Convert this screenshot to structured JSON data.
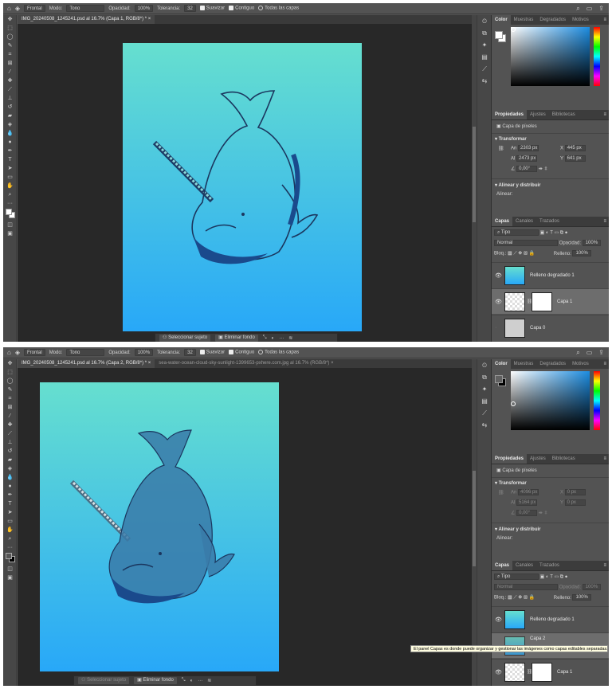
{
  "optbar": {
    "mode_label": "Frontal",
    "modo_label": "Modo:",
    "modo_value": "Tono",
    "opacidad_label": "Opacidad:",
    "opacidad_value": "100%",
    "tolerancia_label": "Tolerancia:",
    "tolerancia_value": "32",
    "suavizar": "Suavizar",
    "contiguo": "Contiguo",
    "todas": "Todas las capas"
  },
  "top": {
    "tabs": [
      {
        "label": "IMG_20240508_1245241.psd al 16.7% (Capa 1, RGB/8*) *"
      }
    ],
    "ctx": {
      "select": "Seleccionar sujeto",
      "remove": "Eliminar fondo",
      "more": "···"
    },
    "props": {
      "layer_type": "Capa de píxeles",
      "transform": "Transformar",
      "an_label": "An",
      "an": "2303 px",
      "al_label": "Al",
      "al": "2473 px",
      "x_label": "X",
      "x": "445 px",
      "y_label": "Y",
      "y": "641 px",
      "angle": "0,00°",
      "align": "Alinear y distribuir",
      "align_sub": "Alinear:"
    },
    "layers": [
      {
        "name": "Relleno degradado 1",
        "visible": true
      },
      {
        "name": "Capa 1",
        "visible": true,
        "selected": true
      },
      {
        "name": "Capa 0",
        "visible": false
      }
    ]
  },
  "bottom": {
    "tabs": [
      {
        "label": "IMG_20240508_1245241.psd al 16.7% (Capa 2, RGB/8*) *"
      },
      {
        "label": "sea-water-ocean-cloud-sky-sunlight-1399653-pxhere.com.jpg al 16.7% (RGB/8*)"
      }
    ],
    "ctx": {
      "select": "Seleccionar sujeto",
      "remove": "Eliminar fondo",
      "more": "···"
    },
    "props": {
      "layer_type": "Capa de píxeles",
      "transform": "Transformar",
      "an_label": "An",
      "an": "4096 px",
      "al_label": "Al",
      "al": "5164 px",
      "x_label": "X",
      "x": "0 px",
      "y_label": "Y",
      "y": "0 px",
      "angle": "0,00°",
      "align": "Alinear y distribuir",
      "align_sub": "Alinear:"
    },
    "layers": [
      {
        "name": "Relleno degradado 1",
        "visible": true
      },
      {
        "name": "Capa 2",
        "visible": false
      },
      {
        "name": "Capa 1",
        "visible": true
      }
    ],
    "tooltip": "El panel Capas es donde puede organizar y gestionar las imágenes como capas editables separadas."
  },
  "panel_tabs": {
    "color": [
      "Color",
      "Muestras",
      "Degradados",
      "Motivos"
    ],
    "props": [
      "Propiedades",
      "Ajustes",
      "Bibliotecas"
    ],
    "layers": [
      "Capas",
      "Canales",
      "Trazados"
    ]
  },
  "layers_panel": {
    "kind": "Tipo",
    "blend": "Normal",
    "opacity_label": "Opacidad:",
    "opacity": "100%",
    "lock_label": "Bloq.:",
    "fill_label": "Relleno:",
    "fill": "100%"
  },
  "colors": {
    "gradient_top": "#66dfcf",
    "gradient_bottom": "#28a8f8",
    "ps_panel": "#535353",
    "ps_canvas": "#282828"
  }
}
